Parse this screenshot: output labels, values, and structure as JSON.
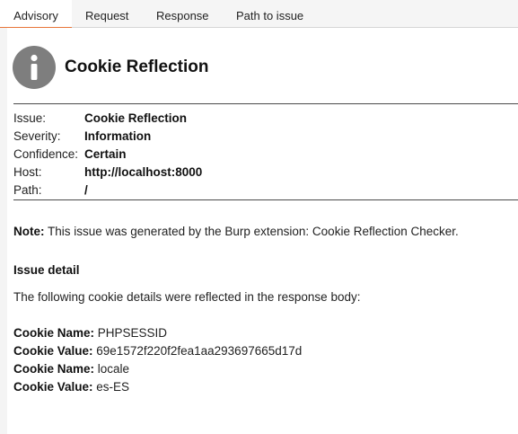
{
  "tabs": [
    {
      "label": "Advisory"
    },
    {
      "label": "Request"
    },
    {
      "label": "Response"
    },
    {
      "label": "Path to issue"
    }
  ],
  "active_tab_index": 0,
  "colors": {
    "accent": "#e8763a",
    "icon_bg": "#7e7e7e"
  },
  "advisory": {
    "icon": "info-icon",
    "title": "Cookie Reflection",
    "meta": [
      {
        "label": "Issue:",
        "value": "Cookie Reflection"
      },
      {
        "label": "Severity:",
        "value": "Information"
      },
      {
        "label": "Confidence:",
        "value": "Certain"
      },
      {
        "label": "Host:",
        "value": "http://localhost:8000"
      },
      {
        "label": "Path:",
        "value": "/"
      }
    ],
    "note_label": "Note:",
    "note_text": " This issue was generated by the Burp extension: Cookie Reflection Checker.",
    "detail_heading": "Issue detail",
    "detail_intro": "The following cookie details were reflected in the response body:",
    "cookies": [
      {
        "label": "Cookie Name:",
        "value": " PHPSESSID"
      },
      {
        "label": "Cookie Value:",
        "value": " 69e1572f220f2fea1aa293697665d17d"
      },
      {
        "label": "Cookie Name:",
        "value": " locale"
      },
      {
        "label": "Cookie Value:",
        "value": " es-ES"
      }
    ]
  }
}
